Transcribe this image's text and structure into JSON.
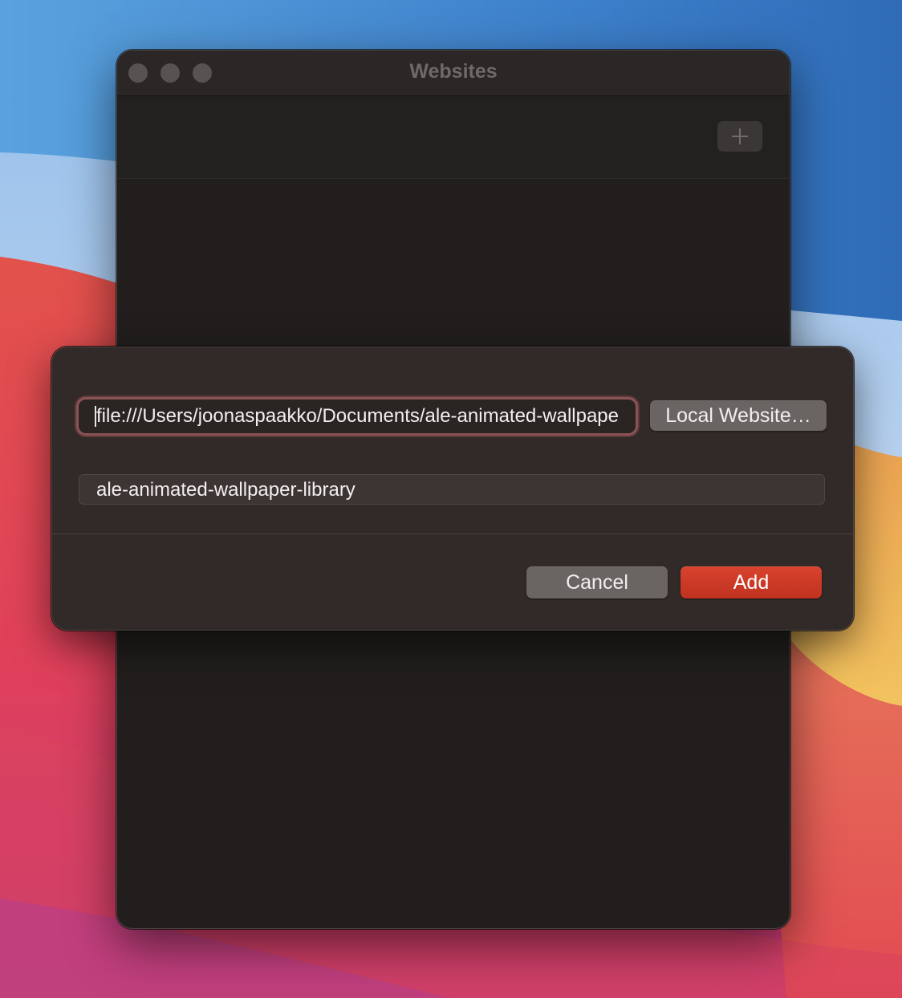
{
  "window": {
    "title": "Websites"
  },
  "toolbar": {
    "add_icon": "plus-icon"
  },
  "sheet": {
    "url_field": {
      "value": "file:///Users/joonaspaakko/Documents/ale-animated-wallpaper-library"
    },
    "local_website_button": "Local Website…",
    "name_field": {
      "value": "ale-animated-wallpaper-library"
    },
    "cancel_button": "Cancel",
    "add_button": "Add"
  },
  "colors": {
    "accent": "#c9392a",
    "focus_ring": "#8a5355",
    "window_bg": "#211e1d",
    "sheet_bg": "#322a28"
  }
}
